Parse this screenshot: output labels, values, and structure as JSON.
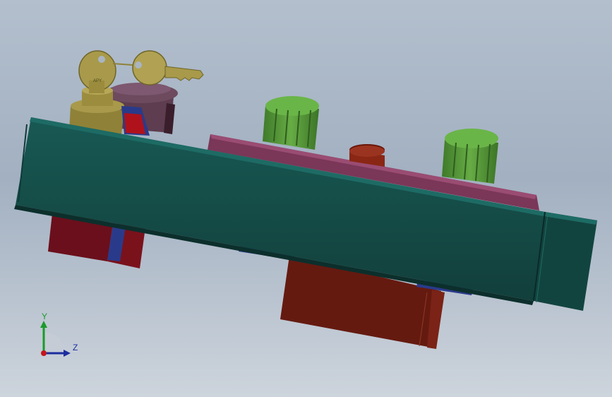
{
  "viewport": {
    "background_top": "#b3bfcd",
    "background_bottom": "#cdd4dc"
  },
  "model": {
    "key_inscription": "APY",
    "colors": {
      "panel": "#144d48",
      "panel_edge": "#0f3b37",
      "strip": "#7a3758",
      "knob": "#5a9c3c",
      "red_block": "#6b0f1c",
      "brown_block": "#651a10",
      "key": "#a89a4a",
      "mushroom": "#5d3d4f",
      "blue": "#2a3a8a"
    }
  },
  "triad": {
    "y_label": "Y",
    "z_label": "Z",
    "y_color": "#1a9a2a",
    "z_color": "#1c2e9e",
    "origin_color": "#c4161c"
  }
}
